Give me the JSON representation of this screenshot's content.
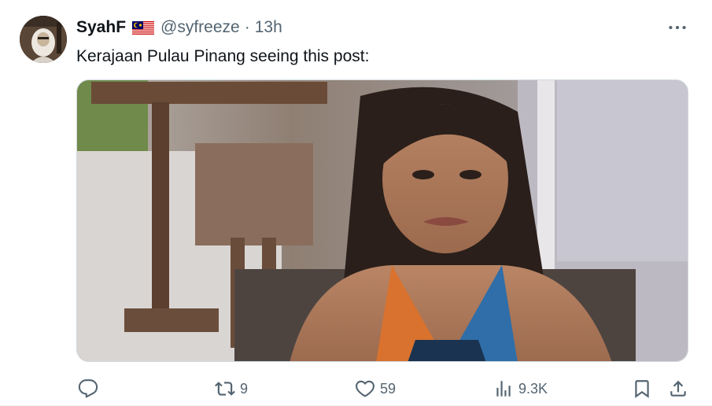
{
  "tweet": {
    "author": {
      "display_name": "SyahF",
      "flag_icon": "malaysia-flag-icon",
      "handle": "@syfreeze",
      "separator": "·",
      "time": "13h"
    },
    "text": "Kerajaan Pulau Pinang seeing this post:",
    "media": {
      "description_icon": "photo-woman-seated-icon"
    },
    "actions": {
      "reply": {
        "icon": "reply-icon",
        "count": ""
      },
      "retweet": {
        "icon": "retweet-icon",
        "count": "9"
      },
      "like": {
        "icon": "heart-icon",
        "count": "59"
      },
      "views": {
        "icon": "views-chart-icon",
        "count": "9.3K"
      },
      "bookmark": {
        "icon": "bookmark-icon"
      },
      "share": {
        "icon": "share-icon"
      }
    },
    "colors": {
      "text": "#0f1419",
      "muted": "#536471",
      "border": "#cfd9de"
    }
  }
}
